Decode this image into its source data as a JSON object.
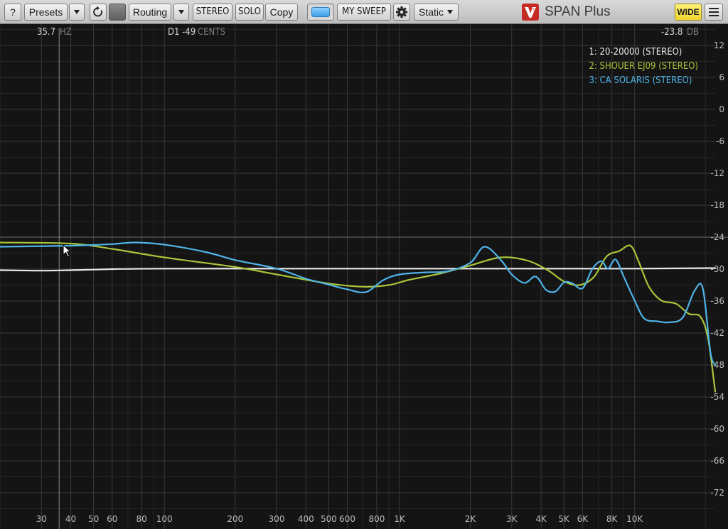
{
  "toolbar": {
    "help": "?",
    "presets": "Presets",
    "routing": "Routing",
    "stereo": "STEREO",
    "solo": "SOLO",
    "copy": "Copy",
    "mysweep": "MY SWEEP",
    "static": "Static",
    "product": "SPAN Plus",
    "wide": "WIDE"
  },
  "colors": {
    "toolbar_bg": "#c9c9c9",
    "plot_bg": "#141414",
    "grid": "#3a3a3a",
    "series1": "#e8e8e8",
    "series2": "#a9c53a",
    "series3": "#4fb3e8",
    "wide_accent": "#f3dc3b",
    "logo_red": "#c52a25"
  },
  "readout": {
    "freq_value": "35.7",
    "freq_unit": "HZ",
    "note_value": "D1 -49",
    "note_unit": "CENTS",
    "level_value": "-23.8",
    "level_unit": "DB"
  },
  "legend": [
    {
      "label": "1: 20-20000 (STEREO)",
      "color": "#e8e8e8"
    },
    {
      "label": "2: SHOUER EJ09 (STEREO)",
      "color": "#a9c53a"
    },
    {
      "label": "3: CA SOLARIS (STEREO)",
      "color": "#4fb3e8"
    }
  ],
  "chart_data": {
    "type": "line",
    "xscale": "log",
    "xlim": [
      20,
      22000
    ],
    "ylim": [
      -76,
      16
    ],
    "x_ticks": [
      30,
      40,
      50,
      60,
      80,
      100,
      200,
      300,
      400,
      500,
      600,
      800,
      1000,
      2000,
      3000,
      4000,
      5000,
      6000,
      8000,
      10000
    ],
    "x_tick_labels": [
      "30",
      "40",
      "50",
      "60",
      "80",
      "100",
      "200",
      "300",
      "400",
      "500",
      "600",
      "800",
      "1K",
      "2K",
      "3K",
      "4K",
      "5K",
      "6K",
      "8K",
      "10K"
    ],
    "y_ticks": [
      12,
      6,
      0,
      -6,
      -12,
      -18,
      -24,
      -30,
      -36,
      -42,
      -48,
      -54,
      -60,
      -66,
      -72
    ],
    "y_tick_labels": [
      "12",
      "6",
      "0",
      "-6",
      "-12",
      "-18",
      "-24",
      "-30",
      "-36",
      "-42",
      "-48",
      "-54",
      "-60",
      "-66",
      "-72"
    ],
    "grid": true,
    "legend_position": "top-right",
    "series": [
      {
        "name": "1: 20-20000 (STEREO)",
        "color": "#e8e8e8",
        "x": [
          20,
          30,
          40,
          60,
          100,
          300,
          1000,
          3000,
          10000,
          22000
        ],
        "y": [
          -30.2,
          -30.3,
          -30.2,
          -30.0,
          -29.9,
          -29.9,
          -29.9,
          -29.9,
          -29.9,
          -29.8
        ]
      },
      {
        "name": "2: SHOUER EJ09 (STEREO)",
        "color": "#a9c53a",
        "x": [
          20,
          40,
          60,
          100,
          200,
          300,
          500,
          700,
          900,
          1100,
          1500,
          2000,
          2700,
          3500,
          4300,
          5000,
          5800,
          6700,
          7600,
          8600,
          9600,
          10400,
          11500,
          13000,
          15000,
          17000,
          19000,
          20500,
          22000
        ],
        "y": [
          -25.0,
          -25.2,
          -26.2,
          -27.8,
          -29.6,
          -31.0,
          -32.7,
          -33.3,
          -33.0,
          -32.0,
          -30.8,
          -29.3,
          -27.8,
          -28.4,
          -30.3,
          -32.3,
          -33.0,
          -31.5,
          -27.6,
          -26.6,
          -25.6,
          -28.6,
          -33.3,
          -35.9,
          -36.5,
          -38.4,
          -38.9,
          -43.0,
          -53.0
        ]
      },
      {
        "name": "3: CA SOLARIS (STEREO)",
        "color": "#4fb3e8",
        "x": [
          20,
          40,
          60,
          75,
          100,
          150,
          200,
          300,
          400,
          500,
          600,
          720,
          850,
          1000,
          1300,
          1600,
          2000,
          2300,
          2700,
          3000,
          3400,
          3800,
          4200,
          4600,
          5000,
          5400,
          6000,
          6600,
          7200,
          7700,
          8300,
          9000,
          10000,
          11000,
          12500,
          14000,
          16000,
          18000,
          19500,
          21000,
          22000
        ],
        "y": [
          -25.8,
          -25.6,
          -25.3,
          -25.0,
          -25.4,
          -26.8,
          -28.3,
          -29.9,
          -31.8,
          -32.9,
          -33.8,
          -34.3,
          -32.1,
          -31.0,
          -30.6,
          -30.4,
          -28.8,
          -25.8,
          -28.3,
          -31.0,
          -32.6,
          -31.4,
          -33.9,
          -34.2,
          -32.5,
          -32.6,
          -33.6,
          -30.0,
          -28.5,
          -29.9,
          -28.2,
          -31.5,
          -35.9,
          -39.3,
          -39.8,
          -40.0,
          -39.1,
          -34.0,
          -33.7,
          -45.6,
          -48.0
        ]
      }
    ]
  }
}
